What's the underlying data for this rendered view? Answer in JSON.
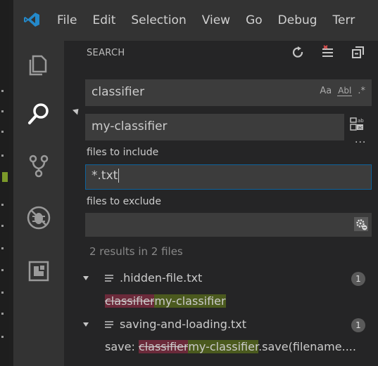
{
  "menu": {
    "items": [
      "File",
      "Edit",
      "Selection",
      "View",
      "Go",
      "Debug",
      "Terr"
    ]
  },
  "activity_bar": {
    "icons": [
      "explorer-icon",
      "search-icon",
      "source-control-icon",
      "debug-icon",
      "extensions-icon"
    ]
  },
  "search": {
    "title": "SEARCH",
    "actions": [
      "refresh-icon",
      "clear-results-icon",
      "collapse-all-icon"
    ],
    "query": "classifier",
    "match_case_label": "Aa",
    "whole_word_label": "Abl",
    "regex_label": ".*",
    "replace_value": "my-classifier",
    "more_label": "···",
    "include_label": "files to include",
    "include_value": "*.txt",
    "exclude_label": "files to exclude",
    "exclude_value": "",
    "summary": "2 results in 2 files"
  },
  "results": [
    {
      "file": ".hidden-file.txt",
      "count": "1",
      "match": {
        "prefix": "",
        "removed": "classifier",
        "added": "my-classifier",
        "suffix": ""
      }
    },
    {
      "file": "saving-and-loading.txt",
      "count": "1",
      "match": {
        "prefix": "save: ",
        "removed": "classifier",
        "added": "my-classifier",
        "suffix": ".save(filename...."
      }
    }
  ],
  "colors": {
    "accent": "#0e639c",
    "removed_bg": "#6b2a3a",
    "added_bg": "#4b5a1e",
    "vscode_blue": "#2489ca"
  }
}
